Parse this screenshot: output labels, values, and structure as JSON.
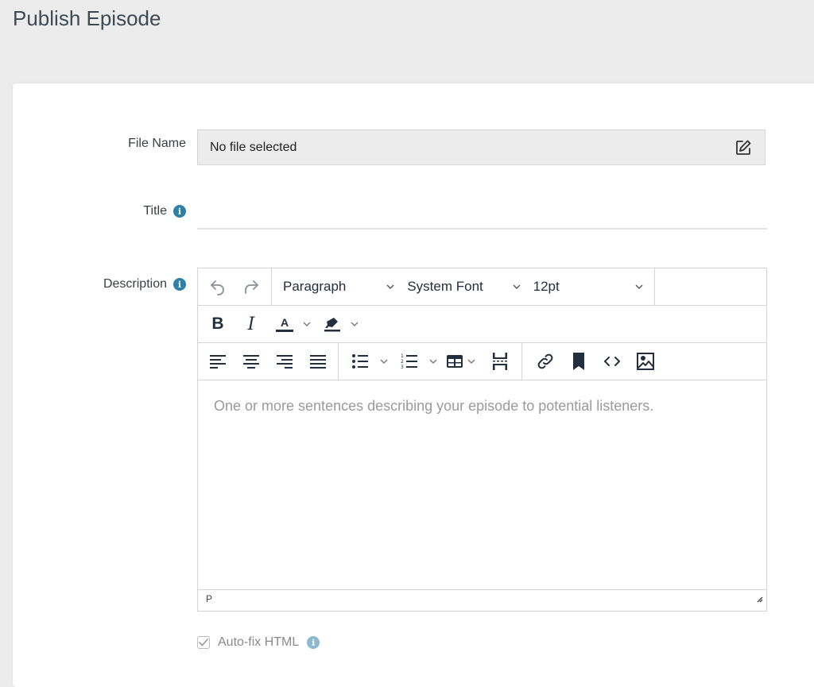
{
  "page": {
    "title": "Publish Episode"
  },
  "form": {
    "file_name": {
      "label": "File Name",
      "value": "No file selected",
      "icon": "edit-icon"
    },
    "title": {
      "label": "Title",
      "value": "",
      "placeholder": "",
      "icon": "info-icon"
    },
    "description": {
      "label": "Description",
      "icon": "info-icon",
      "placeholder": "One or more sentences describing your episode to potential listeners.",
      "status_path": "P",
      "toolbar": {
        "undo_icon": "undo-icon",
        "redo_icon": "redo-icon",
        "block_format": "Paragraph",
        "font_family": "System Font",
        "font_size": "12pt",
        "bold_label": "B",
        "italic_label": "I",
        "text_color_label": "A",
        "icons": [
          "bold-icon",
          "italic-icon",
          "text-color-icon",
          "highlight-icon",
          "align-left-icon",
          "align-center-icon",
          "align-right-icon",
          "align-justify-icon",
          "bullet-list-icon",
          "numbered-list-icon",
          "table-icon",
          "page-break-icon",
          "link-icon",
          "bookmark-icon",
          "code-icon",
          "image-icon"
        ]
      }
    },
    "autofix": {
      "label": "Auto-fix HTML",
      "checked": true,
      "icon": "info-icon"
    }
  },
  "info_glyph": "i",
  "colors": {
    "info": "#2f80a8",
    "toolbar_icon": "#222f3e",
    "placeholder": "#9a9a9a"
  }
}
